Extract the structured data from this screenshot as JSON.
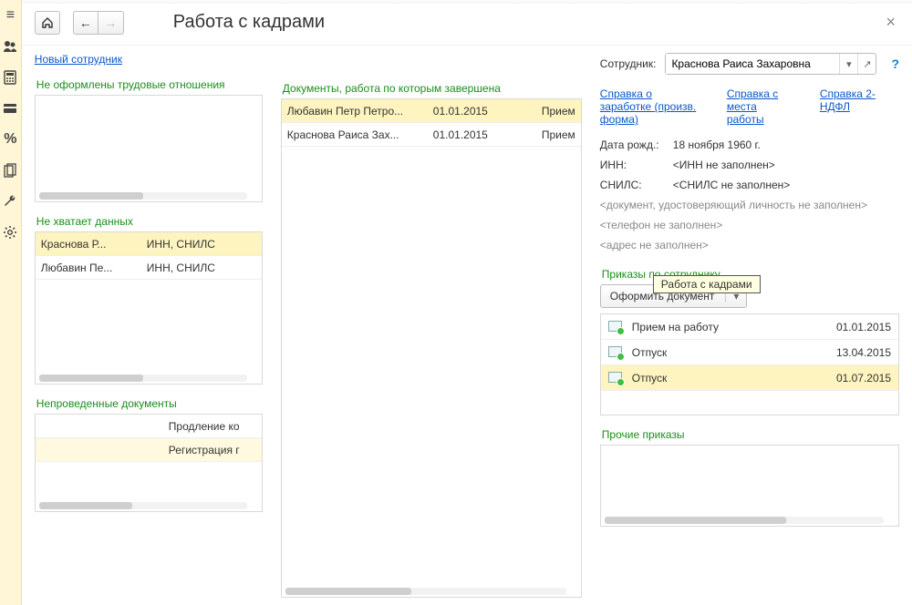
{
  "title": "Работа с кадрами",
  "new_employee_link": "Новый сотрудник",
  "close_label": "×",
  "tooltip_text": "Работа с кадрами",
  "left": {
    "no_relations_header": "Не оформлены трудовые отношения",
    "missing_header": "Не хватает данных",
    "missing_rows": [
      {
        "name": "Краснова Р...",
        "fields": "ИНН, СНИЛС",
        "sel": true
      },
      {
        "name": "Любавин Пе...",
        "fields": "ИНН, СНИЛС",
        "sel": false
      }
    ],
    "unposted_header": "Непроведенные документы",
    "unposted_rows": [
      {
        "c1": "",
        "c2": "Продление ко",
        "sel": false
      },
      {
        "c1": "",
        "c2": "Регистрация г",
        "sel": true
      }
    ]
  },
  "mid": {
    "completed_header": "Документы, работа по которым завершена",
    "rows": [
      {
        "name": "Любавин Петр Петро...",
        "date": "01.01.2015",
        "type": "Прием",
        "sel": true
      },
      {
        "name": "Краснова Раиса Зах...",
        "date": "01.01.2015",
        "type": "Прием",
        "sel": false
      }
    ]
  },
  "right": {
    "employee_label": "Сотрудник:",
    "employee_value": "Краснова Раиса Захаровна",
    "link_salary_cert": "Справка о заработке (произв. форма)",
    "link_work_cert": "Справка с места работы",
    "link_2ndfl": "Справка 2-НДФЛ",
    "dob_label": "Дата рожд.:",
    "dob_value": "18 ноября 1960 г.",
    "inn_label": "ИНН:",
    "inn_value": "<ИНН не заполнен>",
    "snils_label": "СНИЛС:",
    "snils_value": "<СНИЛС не заполнен>",
    "doc_id_placeholder": "<документ, удостоверяющий личность не заполнен>",
    "phone_placeholder": "<телефон не заполнен>",
    "address_placeholder": "<адрес не заполнен>",
    "orders_header": "Приказы по сотруднику",
    "make_doc_btn": "Оформить документ",
    "orders": [
      {
        "title": "Прием на работу",
        "date": "01.01.2015",
        "sel": false
      },
      {
        "title": "Отпуск",
        "date": "13.04.2015",
        "sel": false
      },
      {
        "title": "Отпуск",
        "date": "01.07.2015",
        "sel": true
      }
    ],
    "other_orders_header": "Прочие приказы"
  }
}
